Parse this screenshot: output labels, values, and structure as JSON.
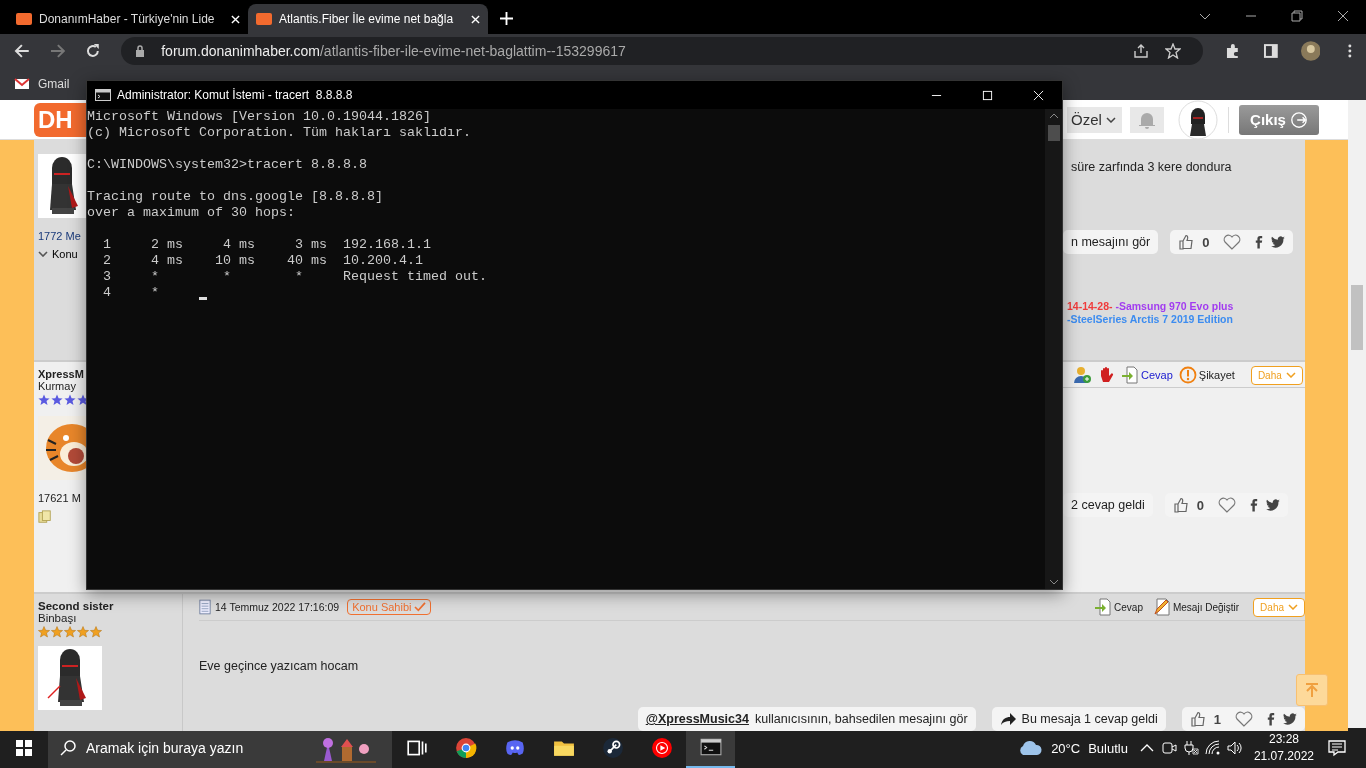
{
  "browser": {
    "tabs": [
      {
        "title": "DonanımHaber - Türkiye'nin Lide",
        "selected": false
      },
      {
        "title": "Atlantis.Fiber İle evime net bağla",
        "selected": true
      }
    ],
    "address": {
      "domain": "forum.donanimhaber.com",
      "path": "/atlantis-fiber-ile-evime-net-baglattim--153299617"
    },
    "bookmarks": [
      "Gmail"
    ]
  },
  "site_header": {
    "logo": "DH",
    "menu": "Özel",
    "logout": "Çıkış"
  },
  "post_1": {
    "post_count": "1772 Me",
    "toggle": "Konu",
    "text": "süre zarfında 3 kere dondura",
    "quote_link": "n mesajını gör",
    "likes": "0",
    "signature_lines": [
      {
        "segments": [
          {
            "text": "14-14-28-",
            "color": "#f03c3c"
          },
          {
            "text": " -Samsung 970 Evo plus",
            "color": "#a23cf0"
          }
        ]
      },
      {
        "segments": [
          {
            "text": "-SteelSeries Arctis 7 2019 Edition",
            "color": "#3c8cf0"
          }
        ]
      }
    ]
  },
  "post_2": {
    "author": "XpressM",
    "rank": "Kurmay",
    "rank_stars": {
      "stars": 4,
      "color": "#5a5ae0"
    },
    "post_count": "17621 M",
    "actions": [
      {
        "kind": "add-user"
      },
      {
        "kind": "block"
      },
      {
        "kind": "reply",
        "label": "Cevap"
      },
      {
        "kind": "report",
        "label": "Şikayet"
      },
      {
        "kind": "more",
        "label": "Daha"
      }
    ],
    "replies_link": "2 cevap geldi",
    "likes": "0"
  },
  "post_3": {
    "author": "Second sister",
    "rank": "Binbaşı",
    "rank_stars": {
      "stars": 5,
      "color": "#f0a020"
    },
    "date": "14 Temmuz 2022 17:16:09",
    "badge": "Konu Sahibi",
    "actions": [
      {
        "kind": "reply",
        "label": "Cevap"
      },
      {
        "kind": "edit",
        "label": "Mesajı Değiştir"
      },
      {
        "kind": "more",
        "label": "Daha"
      }
    ],
    "body": "Eve geçince yazıcam hocam",
    "mention": "@XpressMusic34",
    "mention_text": " kullanıcısının, bahsedilen mesajını gör",
    "replies_link": "Bu mesaja 1 cevap geldi",
    "likes": "1"
  },
  "console": {
    "title": "Administrator: Komut İstemi - tracert  8.8.8.8",
    "blocks": [
      [
        "Microsoft Windows [Version 10.0.19044.1826]",
        "(c) Microsoft Corporation. Tüm hakları saklıdır."
      ],
      [
        "C:\\WINDOWS\\system32>tracert 8.8.8.8"
      ],
      [
        "Tracing route to dns.google [8.8.8.8]",
        "over a maximum of 30 hops:"
      ],
      [
        "  1     2 ms     4 ms     3 ms  192.168.1.1",
        "  2     4 ms    10 ms    40 ms  10.200.4.1",
        "  3     *        *        *     Request timed out.",
        "  4     *"
      ]
    ]
  },
  "taskbar": {
    "search_placeholder": "Aramak için buraya yazın",
    "apps": [
      {
        "kind": "task-view",
        "selected": false
      },
      {
        "kind": "chrome",
        "selected": false
      },
      {
        "kind": "discord",
        "selected": false
      },
      {
        "kind": "folder",
        "selected": false
      },
      {
        "kind": "steam",
        "selected": false
      },
      {
        "kind": "music",
        "selected": false
      },
      {
        "kind": "console",
        "selected": true
      }
    ],
    "weather": {
      "temp": "20°C",
      "condition": "Bulutlu"
    },
    "clock": {
      "time": "23:28",
      "date": "21.07.2022"
    }
  }
}
